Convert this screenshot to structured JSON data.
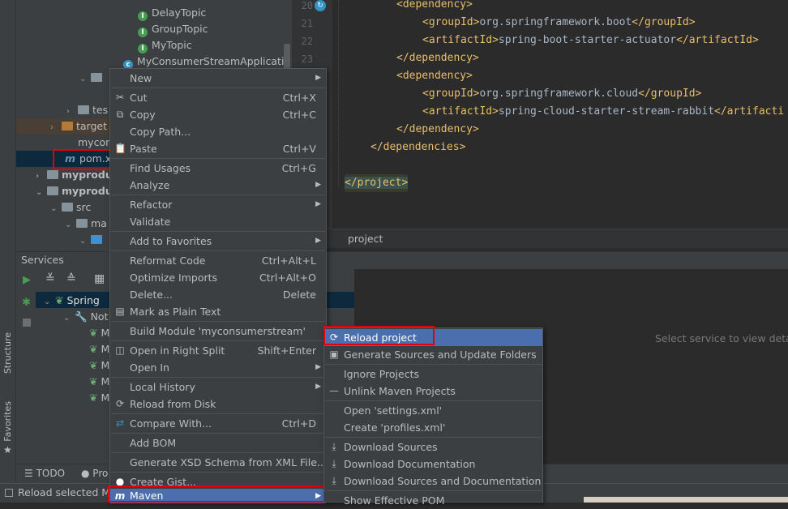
{
  "project_tree": {
    "items": [
      {
        "label": "DelayTopic"
      },
      {
        "label": "GroupTopic"
      },
      {
        "label": "MyTopic"
      },
      {
        "label": "MyConsumerStreamApplicatio"
      },
      {
        "label": "tes"
      },
      {
        "label": "target"
      },
      {
        "label": "mycon"
      },
      {
        "label": "pom.x"
      },
      {
        "label": "myprodu"
      },
      {
        "label": "myprodu"
      },
      {
        "label": "src"
      },
      {
        "label": "ma"
      }
    ]
  },
  "editor": {
    "line_numbers": [
      "20",
      "21",
      "22",
      "23"
    ],
    "lines": [
      {
        "tag_open": "<dependency>",
        "text": "",
        "tag_close": ""
      },
      {
        "tag_open": "<groupId>",
        "text": "org.springframework.boot",
        "tag_close": "</groupId>"
      },
      {
        "tag_open": "<artifactId>",
        "text": "spring-boot-starter-actuator",
        "tag_close": "</artifactId>"
      },
      {
        "tag_open": "</dependency>",
        "text": "",
        "tag_close": ""
      },
      {
        "tag_open": "<dependency>",
        "text": "",
        "tag_close": ""
      },
      {
        "tag_open": "<groupId>",
        "text": "org.springframework.cloud",
        "tag_close": "</groupId>"
      },
      {
        "tag_open": "<artifactId>",
        "text": "spring-cloud-starter-stream-rabbit",
        "tag_close": "</artifacti"
      },
      {
        "tag_open": "</dependency>",
        "text": "",
        "tag_close": ""
      },
      {
        "tag_open": "</dependencies>",
        "text": "",
        "tag_close": ""
      },
      {
        "tag_open": "",
        "text": "",
        "tag_close": ""
      },
      {
        "tag_open": "</project>",
        "text": "",
        "tag_close": ""
      }
    ],
    "breadcrumb": "project"
  },
  "services": {
    "title": "Services",
    "spring_label": "Spring",
    "not_label": "Not",
    "node_label": "M",
    "placeholder": "Select service to view details"
  },
  "side_labels": {
    "structure": "Structure",
    "favorites": "Favorites"
  },
  "bottom_tabs": {
    "todo": "TODO",
    "problems": "Pro"
  },
  "status": {
    "text": "Reload selected M"
  },
  "context_menu": {
    "items": [
      {
        "label": "New",
        "shortcut": "",
        "submenu": true,
        "icon": ""
      },
      {
        "label": "Cut",
        "shortcut": "Ctrl+X",
        "submenu": false,
        "icon": "✂"
      },
      {
        "label": "Copy",
        "shortcut": "Ctrl+C",
        "submenu": false,
        "icon": "⧉"
      },
      {
        "label": "Copy Path...",
        "shortcut": "",
        "submenu": false,
        "icon": ""
      },
      {
        "label": "Paste",
        "shortcut": "Ctrl+V",
        "submenu": false,
        "icon": "📋"
      },
      {
        "label": "Find Usages",
        "shortcut": "Ctrl+G",
        "submenu": false,
        "icon": ""
      },
      {
        "label": "Analyze",
        "shortcut": "",
        "submenu": true,
        "icon": ""
      },
      {
        "label": "Refactor",
        "shortcut": "",
        "submenu": true,
        "icon": ""
      },
      {
        "label": "Validate",
        "shortcut": "",
        "submenu": false,
        "icon": ""
      },
      {
        "label": "Add to Favorites",
        "shortcut": "",
        "submenu": true,
        "icon": ""
      },
      {
        "label": "Reformat Code",
        "shortcut": "Ctrl+Alt+L",
        "submenu": false,
        "icon": ""
      },
      {
        "label": "Optimize Imports",
        "shortcut": "Ctrl+Alt+O",
        "submenu": false,
        "icon": ""
      },
      {
        "label": "Delete...",
        "shortcut": "Delete",
        "submenu": false,
        "icon": ""
      },
      {
        "label": "Mark as Plain Text",
        "shortcut": "",
        "submenu": false,
        "icon": "▤"
      },
      {
        "label": "Build Module 'myconsumerstream'",
        "shortcut": "",
        "submenu": false,
        "icon": ""
      },
      {
        "label": "Open in Right Split",
        "shortcut": "Shift+Enter",
        "submenu": false,
        "icon": "◫"
      },
      {
        "label": "Open In",
        "shortcut": "",
        "submenu": true,
        "icon": ""
      },
      {
        "label": "Local History",
        "shortcut": "",
        "submenu": true,
        "icon": ""
      },
      {
        "label": "Reload from Disk",
        "shortcut": "",
        "submenu": false,
        "icon": "⟳"
      },
      {
        "label": "Compare With...",
        "shortcut": "Ctrl+D",
        "submenu": false,
        "icon": "⇄"
      },
      {
        "label": "Add BOM",
        "shortcut": "",
        "submenu": false,
        "icon": ""
      },
      {
        "label": "Generate XSD Schema from XML File...",
        "shortcut": "",
        "submenu": false,
        "icon": ""
      },
      {
        "label": "Create Gist...",
        "shortcut": "",
        "submenu": false,
        "icon": "●"
      },
      {
        "label": "Maven",
        "shortcut": "",
        "submenu": true,
        "icon": "m"
      }
    ]
  },
  "maven_submenu": {
    "items": [
      {
        "label": "Reload project",
        "icon": "⟳"
      },
      {
        "label": "Generate Sources and Update Folders",
        "icon": "▣"
      },
      {
        "label": "Ignore Projects",
        "icon": ""
      },
      {
        "label": "Unlink Maven Projects",
        "icon": "—"
      },
      {
        "label": "Open 'settings.xml'",
        "icon": ""
      },
      {
        "label": "Create 'profiles.xml'",
        "icon": ""
      },
      {
        "label": "Download Sources",
        "icon": "⤓"
      },
      {
        "label": "Download Documentation",
        "icon": "⤓"
      },
      {
        "label": "Download Sources and Documentation",
        "icon": "⤓"
      },
      {
        "label": "Show Effective POM",
        "icon": ""
      }
    ]
  }
}
